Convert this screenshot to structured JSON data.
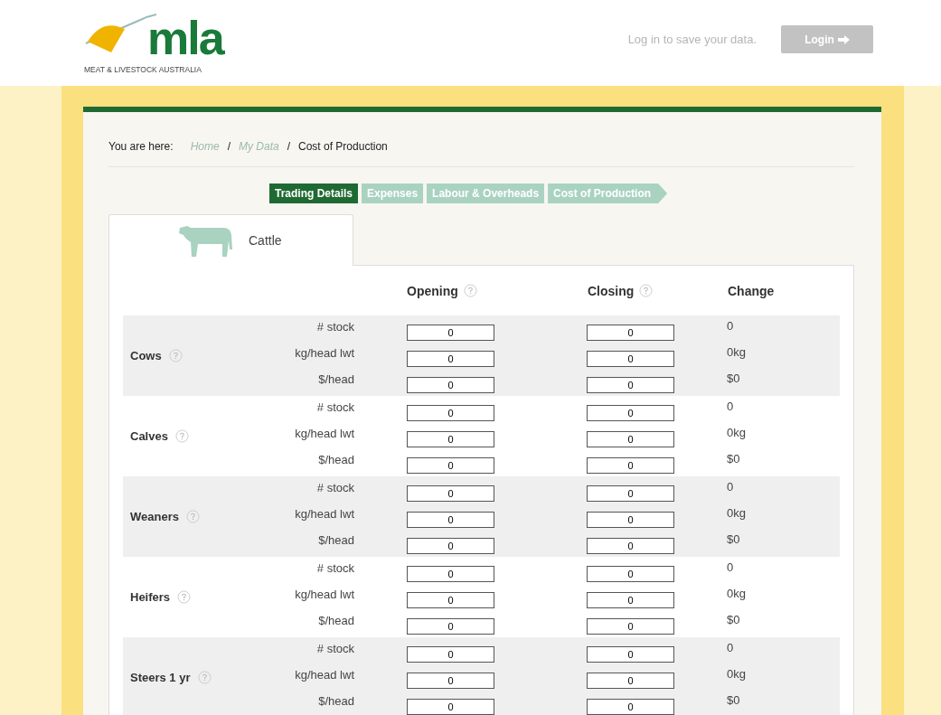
{
  "header": {
    "logo_word": "mla",
    "logo_tagline": "MEAT & LIVESTOCK AUSTRALIA",
    "login_hint": "Log in to save your data.",
    "login_button": "Login"
  },
  "breadcrumb": {
    "prefix": "You are here:",
    "items": [
      {
        "label": "Home",
        "current": false
      },
      {
        "label": "My Data",
        "current": false
      },
      {
        "label": "Cost of Production",
        "current": true
      }
    ],
    "separator": "/"
  },
  "steps": [
    {
      "label": "Trading Details",
      "selected": true
    },
    {
      "label": "Expenses",
      "selected": false
    },
    {
      "label": "Labour & Overheads",
      "selected": false
    },
    {
      "label": "Cost of Production",
      "selected": false
    }
  ],
  "tabs": [
    {
      "label": "Cattle",
      "selected": true
    }
  ],
  "table": {
    "columns": [
      "Opening",
      "Closing",
      "Change"
    ],
    "groups": [
      {
        "name": "Cows",
        "rows": [
          {
            "label": "# stock",
            "opening": "0",
            "closing": "0",
            "change": "0"
          },
          {
            "label": "kg/head lwt",
            "opening": "0",
            "closing": "0",
            "change": "0kg"
          },
          {
            "label": "$/head",
            "opening": "0",
            "closing": "0",
            "change": "$0"
          }
        ]
      },
      {
        "name": "Calves",
        "rows": [
          {
            "label": "# stock",
            "opening": "0",
            "closing": "0",
            "change": "0"
          },
          {
            "label": "kg/head lwt",
            "opening": "0",
            "closing": "0",
            "change": "0kg"
          },
          {
            "label": "$/head",
            "opening": "0",
            "closing": "0",
            "change": "$0"
          }
        ]
      },
      {
        "name": "Weaners",
        "rows": [
          {
            "label": "# stock",
            "opening": "0",
            "closing": "0",
            "change": "0"
          },
          {
            "label": "kg/head lwt",
            "opening": "0",
            "closing": "0",
            "change": "0kg"
          },
          {
            "label": "$/head",
            "opening": "0",
            "closing": "0",
            "change": "$0"
          }
        ]
      },
      {
        "name": "Heifers",
        "rows": [
          {
            "label": "# stock",
            "opening": "0",
            "closing": "0",
            "change": "0"
          },
          {
            "label": "kg/head lwt",
            "opening": "0",
            "closing": "0",
            "change": "0kg"
          },
          {
            "label": "$/head",
            "opening": "0",
            "closing": "0",
            "change": "$0"
          }
        ]
      },
      {
        "name": "Steers 1 yr",
        "rows": [
          {
            "label": "# stock",
            "opening": "0",
            "closing": "0",
            "change": "0"
          },
          {
            "label": "kg/head lwt",
            "opening": "0",
            "closing": "0",
            "change": "0kg"
          },
          {
            "label": "$/head",
            "opening": "0",
            "closing": "0",
            "change": "$0"
          }
        ]
      }
    ]
  }
}
